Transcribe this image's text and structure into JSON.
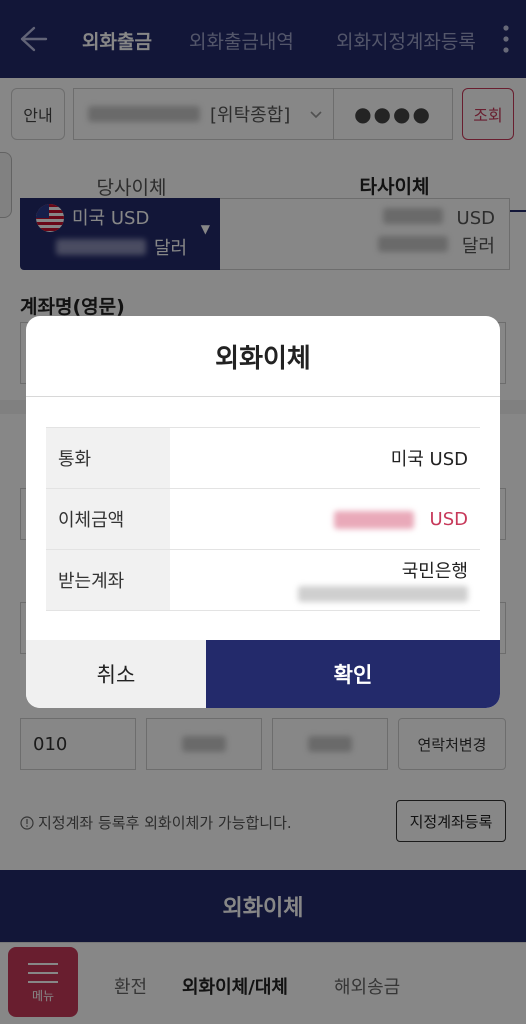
{
  "header": {
    "tabs": [
      {
        "label": "외화출금",
        "active": true
      },
      {
        "label": "외화출금내역",
        "active": false
      },
      {
        "label": "외화지정계좌등록",
        "active": false
      }
    ]
  },
  "account": {
    "guide_label": "안내",
    "account_type": "[위탁종합]",
    "password_mask": "●●●●",
    "search_label": "조회"
  },
  "transfer_tabs": [
    {
      "label": "당사이체",
      "active": false
    },
    {
      "label": "타사이체",
      "active": true
    }
  ],
  "currency": {
    "name": "미국 USD",
    "sub_unit": "달러",
    "amount_unit": "USD",
    "amount_sub_unit": "달러"
  },
  "form": {
    "eng_name_label": "계좌명(영문)",
    "phone_prefix": "010",
    "contact_change_label": "연락처변경",
    "notice": "지정계좌 등록후 외화이체가 가능합니다.",
    "register_label": "지정계좌등록",
    "submit_label": "외화이체"
  },
  "dialog": {
    "title": "외화이체",
    "rows": [
      {
        "key": "통화",
        "value": "미국 USD"
      },
      {
        "key": "이체금액",
        "value": "USD"
      },
      {
        "key": "받는계좌",
        "value": "국민은행"
      }
    ],
    "cancel_label": "취소",
    "confirm_label": "확인"
  },
  "bottom_nav": {
    "menu_label": "메뉴",
    "items": [
      {
        "label": "환전",
        "active": false
      },
      {
        "label": "외화이체/대체",
        "active": true
      },
      {
        "label": "해외송금",
        "active": false
      }
    ]
  },
  "colors": {
    "primary": "#232a6b",
    "accent": "#c7395a"
  }
}
